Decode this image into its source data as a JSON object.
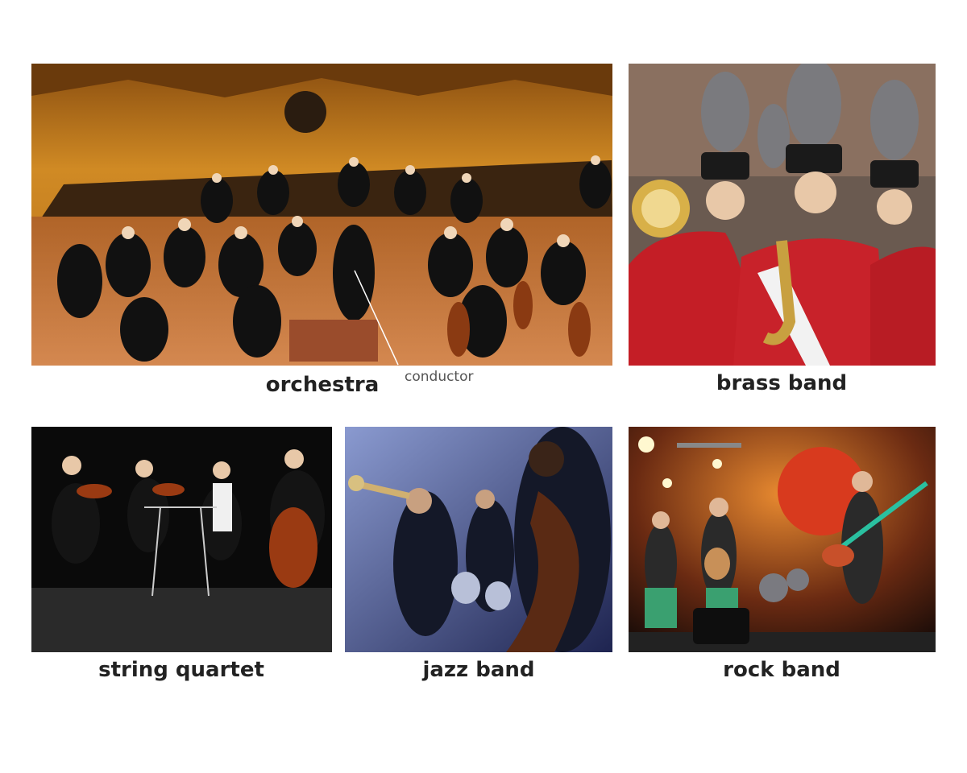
{
  "panels": [
    {
      "id": "orchestra",
      "caption": "orchestra"
    },
    {
      "id": "brass",
      "caption": "brass band"
    },
    {
      "id": "string",
      "caption": "string quartet"
    },
    {
      "id": "jazz",
      "caption": "jazz band"
    },
    {
      "id": "rock",
      "caption": "rock band"
    }
  ],
  "annotation": {
    "label": "conductor"
  },
  "colors": {
    "orchestra_wall": "#c8801e",
    "orchestra_floor": "#b8692a",
    "uniform_red": "#c0202a",
    "jazz_blue": "#4a5a9a",
    "rock_orange": "#d8641c",
    "quartet_black": "#0c0c0c",
    "caption_text": "#222222"
  }
}
